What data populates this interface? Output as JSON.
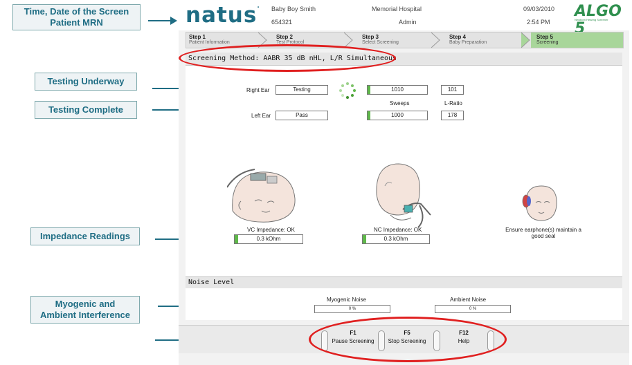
{
  "callouts": {
    "time_date": "Time, Date of the Screen Patient MRN",
    "testing_underway": "Testing Underway",
    "testing_complete": "Testing Complete",
    "impedance": "Impedance Readings",
    "myogenic": "Myogenic and Ambient Interference"
  },
  "header": {
    "logo": "natus",
    "patient_name": "Baby Boy Smith",
    "patient_mrn": "654321",
    "hospital": "Memorial Hospital",
    "user": "Admin",
    "date": "09/03/2010",
    "time": "2:54 PM",
    "product_logo": "ALGO 5",
    "product_tagline": "Newborn Hearing Screener"
  },
  "steps": [
    {
      "num": "Step 1",
      "label": "Patient Information"
    },
    {
      "num": "Step 2",
      "label": "Test Protocol"
    },
    {
      "num": "Step 3",
      "label": "Select Screening"
    },
    {
      "num": "Step 4",
      "label": "Baby Preparation"
    },
    {
      "num": "Step 5",
      "label": "Screening"
    }
  ],
  "screening_method": "Screening Method: AABR 35 dB nHL, L/R Simultaneous",
  "ears": {
    "right_label": "Right Ear",
    "right_status": "Testing",
    "right_sweeps": "1010",
    "right_lratio": "101",
    "sweeps_label": "Sweeps",
    "lratio_label": "L-Ratio",
    "left_label": "Left Ear",
    "left_status": "Pass",
    "left_sweeps": "1000",
    "left_lratio": "178"
  },
  "impedance": {
    "vc_label": "VC Impedance:  OK",
    "vc_value": "0.3 kOhm",
    "nc_label": "NC Impedance:  OK",
    "nc_value": "0.3 kOhm",
    "earphone_msg": "Ensure earphone(s) maintain a good seal"
  },
  "noise": {
    "header": "Noise Level",
    "myogenic_label": "Myogenic Noise",
    "myogenic_value": "0 %",
    "ambient_label": "Ambient Noise",
    "ambient_value": "0 %"
  },
  "fkeys": [
    {
      "key": "F1",
      "label": "Pause Screening"
    },
    {
      "key": "F5",
      "label": "Stop Screening"
    },
    {
      "key": "F12",
      "label": "Help"
    }
  ],
  "colors": {
    "brand": "#1f6d84",
    "callout_bg": "#eef3f5",
    "progress_fill": "#5fb84a",
    "active_step": "#a8d69a",
    "highlight": "#e02020"
  }
}
